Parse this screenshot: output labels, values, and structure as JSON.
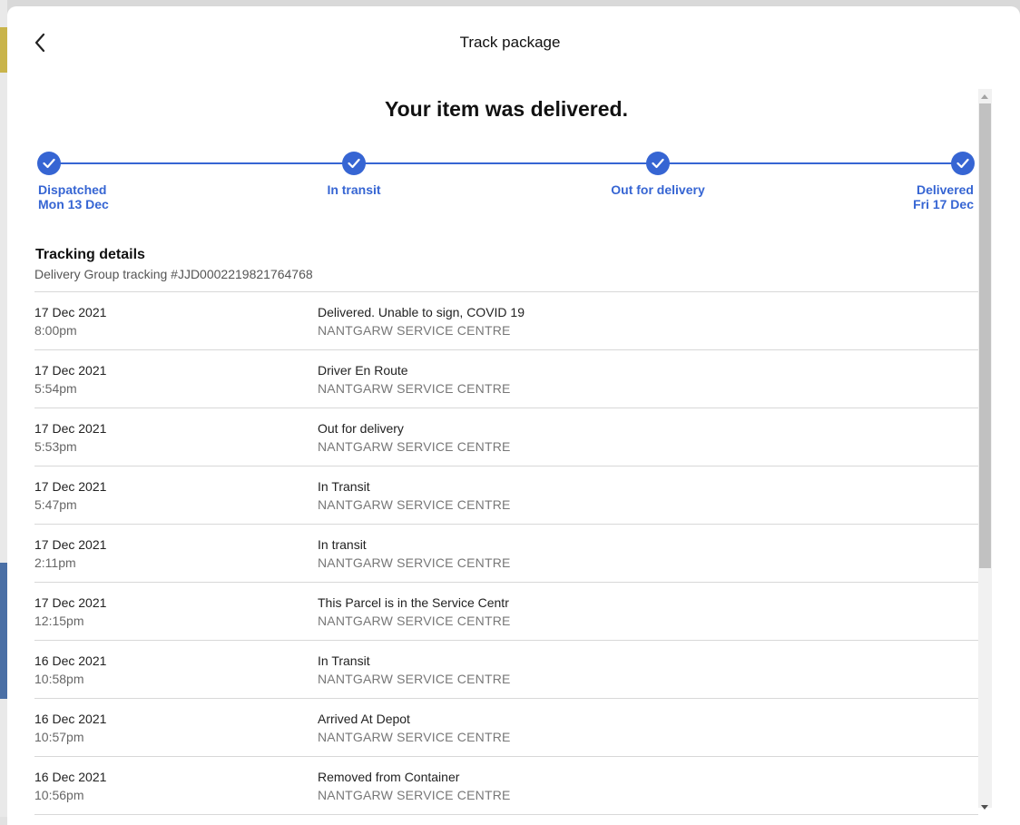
{
  "modal": {
    "title": "Track package",
    "headline": "Your item was delivered."
  },
  "progress": {
    "color": "#3665d3",
    "steps": [
      {
        "label": "Dispatched",
        "sublabel": "Mon 13 Dec",
        "completed": true
      },
      {
        "label": "In transit",
        "sublabel": "",
        "completed": true
      },
      {
        "label": "Out for delivery",
        "sublabel": "",
        "completed": true
      },
      {
        "label": "Delivered",
        "sublabel": "Fri 17 Dec",
        "completed": true
      }
    ]
  },
  "tracking": {
    "title": "Tracking details",
    "subtitle": "Delivery Group tracking #JJD0002219821764768",
    "events": [
      {
        "date": "17 Dec 2021",
        "time": "8:00pm",
        "status": "Delivered. Unable to sign, COVID 19",
        "location": "NANTGARW SERVICE CENTRE"
      },
      {
        "date": "17 Dec 2021",
        "time": "5:54pm",
        "status": "Driver En Route",
        "location": "NANTGARW SERVICE CENTRE"
      },
      {
        "date": "17 Dec 2021",
        "time": "5:53pm",
        "status": "Out for delivery",
        "location": "NANTGARW SERVICE CENTRE"
      },
      {
        "date": "17 Dec 2021",
        "time": "5:47pm",
        "status": "In Transit",
        "location": "NANTGARW SERVICE CENTRE"
      },
      {
        "date": "17 Dec 2021",
        "time": "2:11pm",
        "status": "In transit",
        "location": "NANTGARW SERVICE CENTRE"
      },
      {
        "date": "17 Dec 2021",
        "time": "12:15pm",
        "status": "This Parcel is in the Service Centr",
        "location": "NANTGARW SERVICE CENTRE"
      },
      {
        "date": "16 Dec 2021",
        "time": "10:58pm",
        "status": "In Transit",
        "location": "NANTGARW SERVICE CENTRE"
      },
      {
        "date": "16 Dec 2021",
        "time": "10:57pm",
        "status": "Arrived At Depot",
        "location": "NANTGARW SERVICE CENTRE"
      },
      {
        "date": "16 Dec 2021",
        "time": "10:56pm",
        "status": "Removed from Container",
        "location": "NANTGARW SERVICE CENTRE"
      }
    ]
  },
  "icons": {
    "back": "chevron-left-icon",
    "step_check": "check-icon"
  }
}
